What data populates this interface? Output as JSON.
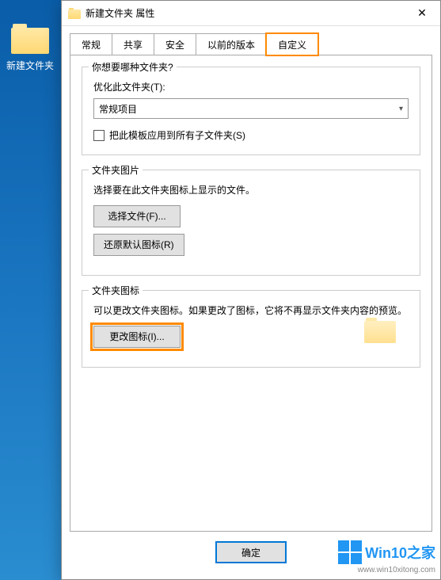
{
  "desktop": {
    "folder_label": "新建文件夹"
  },
  "dialog": {
    "title": "新建文件夹 属性",
    "close_glyph": "✕"
  },
  "tabs": {
    "general": "常规",
    "share": "共享",
    "security": "安全",
    "previous": "以前的版本",
    "custom": "自定义"
  },
  "group_type": {
    "title": "你想要哪种文件夹?",
    "optimize_label": "优化此文件夹(T):",
    "combo_value": "常规项目",
    "apply_template_label": "把此模板应用到所有子文件夹(S)"
  },
  "group_picture": {
    "title": "文件夹图片",
    "desc": "选择要在此文件夹图标上显示的文件。",
    "choose_btn": "选择文件(F)...",
    "restore_btn": "还原默认图标(R)"
  },
  "group_icon": {
    "title": "文件夹图标",
    "desc": "可以更改文件夹图标。如果更改了图标，它将不再显示文件夹内容的预览。",
    "change_btn": "更改图标(I)..."
  },
  "footer": {
    "ok": "确定"
  },
  "watermark": {
    "brand_en": "Win10",
    "brand_zh": "之家",
    "url": "www.win10xitong.com"
  }
}
